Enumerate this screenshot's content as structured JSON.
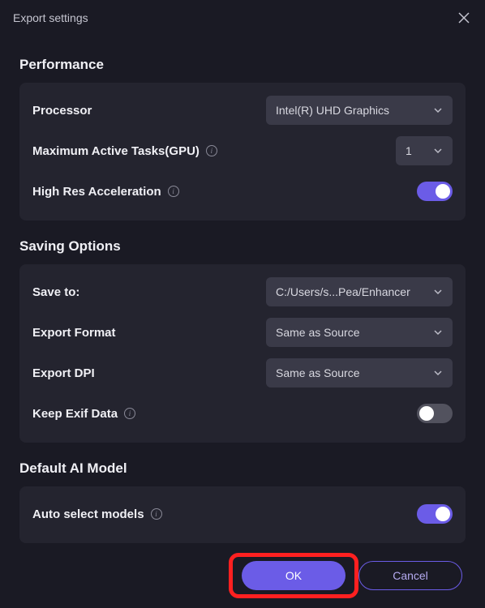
{
  "title": "Export settings",
  "sections": {
    "performance": {
      "title": "Performance",
      "processor": {
        "label": "Processor",
        "value": "Intel(R) UHD Graphics"
      },
      "maxTasks": {
        "label": "Maximum Active Tasks(GPU)",
        "value": "1"
      },
      "highRes": {
        "label": "High Res Acceleration"
      }
    },
    "saving": {
      "title": "Saving Options",
      "saveTo": {
        "label": "Save to:",
        "value": "C:/Users/s...Pea/Enhancer"
      },
      "format": {
        "label": "Export Format",
        "value": "Same as Source"
      },
      "dpi": {
        "label": "Export DPI",
        "value": "Same as Source"
      },
      "exif": {
        "label": "Keep Exif Data"
      }
    },
    "aiModel": {
      "title": "Default AI Model",
      "autoSelect": {
        "label": "Auto select models"
      }
    }
  },
  "buttons": {
    "ok": "OK",
    "cancel": "Cancel"
  }
}
